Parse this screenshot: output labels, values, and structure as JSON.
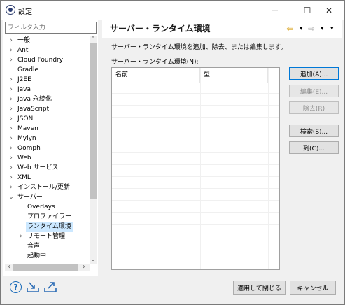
{
  "window": {
    "title": "設定",
    "minimize_glyph": "—",
    "maximize_glyph": "☐",
    "close_glyph": "✕"
  },
  "sidebar": {
    "filter_placeholder": "フィルタ入力",
    "items": [
      {
        "label": "一般",
        "expander": "›"
      },
      {
        "label": "Ant",
        "expander": "›"
      },
      {
        "label": "Cloud Foundry",
        "expander": "›"
      },
      {
        "label": "Gradle",
        "expander": ""
      },
      {
        "label": "J2EE",
        "expander": "›"
      },
      {
        "label": "Java",
        "expander": "›"
      },
      {
        "label": "Java 永続化",
        "expander": "›"
      },
      {
        "label": "JavaScript",
        "expander": "›"
      },
      {
        "label": "JSON",
        "expander": "›"
      },
      {
        "label": "Maven",
        "expander": "›"
      },
      {
        "label": "Mylyn",
        "expander": "›"
      },
      {
        "label": "Oomph",
        "expander": "›"
      },
      {
        "label": "Web",
        "expander": "›"
      },
      {
        "label": "Web サービス",
        "expander": "›"
      },
      {
        "label": "XML",
        "expander": "›"
      },
      {
        "label": "インストール/更新",
        "expander": "›"
      },
      {
        "label": "サーバー",
        "expander": "⌄"
      },
      {
        "label": "Overlays",
        "expander": ""
      },
      {
        "label": "プロファイラー",
        "expander": ""
      },
      {
        "label": "ランタイム環境",
        "expander": ""
      },
      {
        "label": "リモート管理",
        "expander": "›"
      },
      {
        "label": "音声",
        "expander": ""
      },
      {
        "label": "起動中",
        "expander": ""
      }
    ],
    "scroll_up": "⌃",
    "scroll_down": "⌄",
    "scroll_left": "‹",
    "scroll_right": "›"
  },
  "main": {
    "title": "サーバー・ランタイム環境",
    "description": "サーバー・ランタイム環境を追加、除去、または編集します。",
    "list_label": "サーバー・ランタイム環境(N):",
    "columns": [
      "名前",
      "型"
    ],
    "nav": {
      "back": "⇦",
      "dropdown": "▾",
      "forward": "⇨",
      "menu": "▾"
    },
    "buttons": {
      "add": "追加(A)...",
      "edit": "編集(E)...",
      "remove": "除去(R)",
      "search": "検索(S)...",
      "columns": "列(C)..."
    }
  },
  "footer": {
    "help_glyph": "?",
    "apply_close": "適用して閉じる",
    "cancel": "キャンセル"
  }
}
